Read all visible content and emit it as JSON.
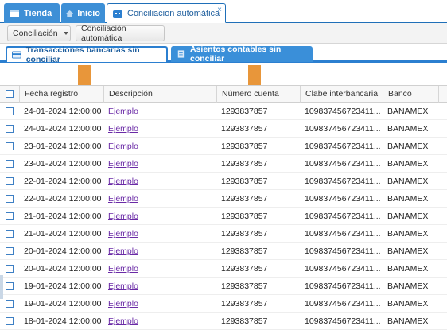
{
  "tabs": {
    "tienda": "Tienda",
    "inicio": "Inicio",
    "active": "Conciliacion automática",
    "close": "×"
  },
  "toolbar": {
    "conciliacion": "Conciliación",
    "automatica": "Conciliación automática"
  },
  "subtabs": {
    "transacciones": "Transacciones bancarias sin conciliar",
    "asientos": "Asientos contables sin conciliar"
  },
  "table": {
    "headers": {
      "fecha": "Fecha registro",
      "descripcion": "Descripción",
      "numero": "Número cuenta",
      "clabe": "Clabe interbancaria",
      "banco": "Banco"
    },
    "rows": [
      {
        "fecha": "24-01-2024 12:00:00",
        "descripcion": "Ejemplo",
        "numero": "1293837857",
        "clabe": "109837456723411...",
        "banco": "BANAMEX"
      },
      {
        "fecha": "24-01-2024 12:00:00",
        "descripcion": "Ejemplo",
        "numero": "1293837857",
        "clabe": "109837456723411...",
        "banco": "BANAMEX"
      },
      {
        "fecha": "23-01-2024 12:00:00",
        "descripcion": "Ejemplo",
        "numero": "1293837857",
        "clabe": "109837456723411...",
        "banco": "BANAMEX"
      },
      {
        "fecha": "23-01-2024 12:00:00",
        "descripcion": "Ejemplo",
        "numero": "1293837857",
        "clabe": "109837456723411...",
        "banco": "BANAMEX"
      },
      {
        "fecha": "22-01-2024 12:00:00",
        "descripcion": "Ejemplo",
        "numero": "1293837857",
        "clabe": "109837456723411...",
        "banco": "BANAMEX"
      },
      {
        "fecha": "22-01-2024 12:00:00",
        "descripcion": "Ejemplo",
        "numero": "1293837857",
        "clabe": "109837456723411...",
        "banco": "BANAMEX"
      },
      {
        "fecha": "21-01-2024 12:00:00",
        "descripcion": "Ejemplo",
        "numero": "1293837857",
        "clabe": "109837456723411...",
        "banco": "BANAMEX"
      },
      {
        "fecha": "21-01-2024 12:00:00",
        "descripcion": "Ejemplo",
        "numero": "1293837857",
        "clabe": "109837456723411...",
        "banco": "BANAMEX"
      },
      {
        "fecha": "20-01-2024 12:00:00",
        "descripcion": "Ejemplo",
        "numero": "1293837857",
        "clabe": "109837456723411...",
        "banco": "BANAMEX"
      },
      {
        "fecha": "20-01-2024 12:00:00",
        "descripcion": "Ejemplo",
        "numero": "1293837857",
        "clabe": "109837456723411...",
        "banco": "BANAMEX"
      },
      {
        "fecha": "19-01-2024 12:00:00",
        "descripcion": "Ejemplo",
        "numero": "1293837857",
        "clabe": "109837456723411...",
        "banco": "BANAMEX"
      },
      {
        "fecha": "19-01-2024 12:00:00",
        "descripcion": "Ejemplo",
        "numero": "1293837857",
        "clabe": "109837456723411...",
        "banco": "BANAMEX"
      },
      {
        "fecha": "18-01-2024 12:00:00",
        "descripcion": "Ejemplo",
        "numero": "1293837857",
        "clabe": "109837456723411...",
        "banco": "BANAMEX"
      }
    ]
  },
  "icons": {
    "tienda": "store-icon",
    "inicio": "home-icon",
    "active": "robot-icon",
    "transacciones": "bank-card-icon",
    "asientos": "document-icon"
  },
  "colors": {
    "accent": "#2b7fd0",
    "marker": "#e8963a",
    "link": "#6a2aa6"
  }
}
